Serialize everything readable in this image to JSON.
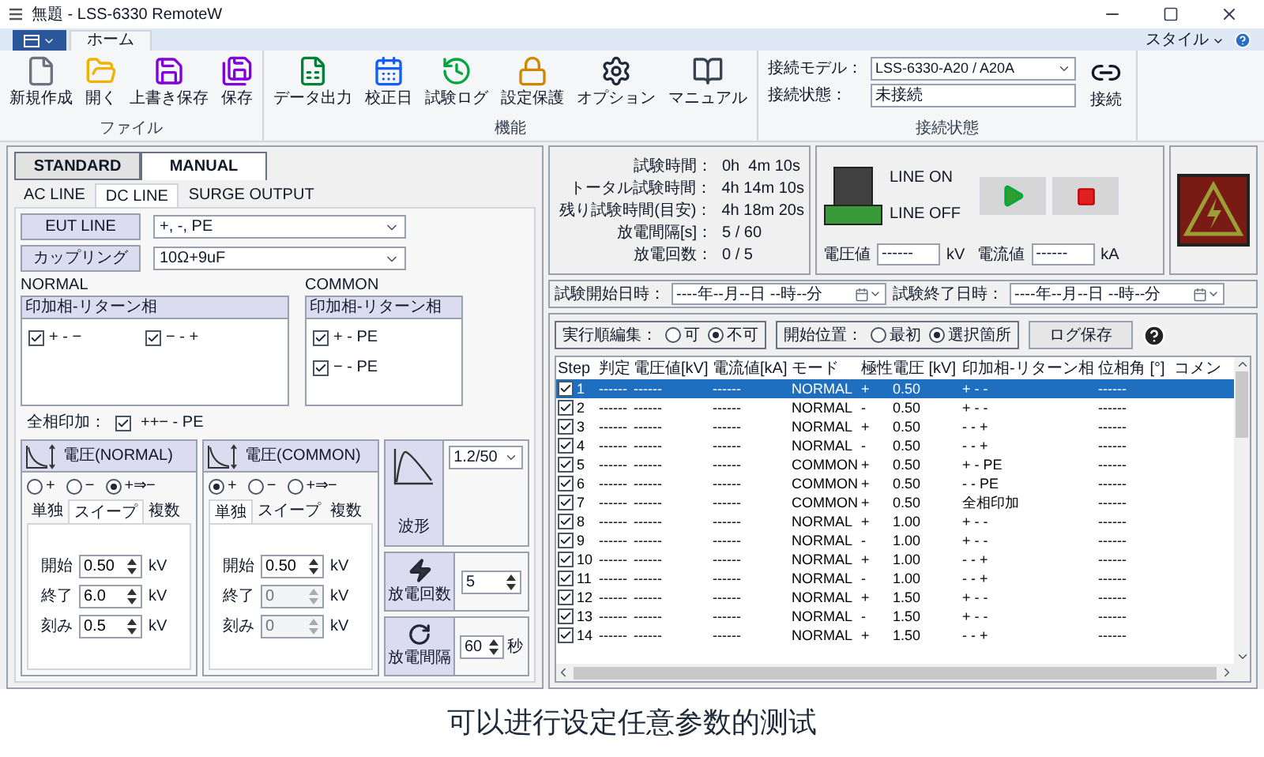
{
  "window": {
    "title": "無題 - LSS-6330 RemoteW",
    "style_menu": "スタイル"
  },
  "ribbon": {
    "tabs": [
      {
        "label": "ホーム",
        "selected": true
      }
    ],
    "groups": [
      {
        "label": "ファイル",
        "buttons": [
          "新規作成",
          "開く",
          "上書き保存",
          "保存"
        ]
      },
      {
        "label": "機能",
        "buttons": [
          "データ出力",
          "校正日",
          "試験ログ",
          "設定保護",
          "オプション",
          "マニュアル"
        ]
      }
    ],
    "connection": {
      "label": "接続状態",
      "model_label": "接続モデル：",
      "model": "LSS-6330-A20 / A20A",
      "status_label": "接続状態：",
      "status": "未接続",
      "connect": "接続"
    }
  },
  "mode_tabs": [
    {
      "label": "STANDARD",
      "selected": false
    },
    {
      "label": "MANUAL",
      "selected": true
    }
  ],
  "line_tabs": [
    {
      "label": "AC LINE",
      "selected": false
    },
    {
      "label": "DC LINE",
      "selected": true
    },
    {
      "label": "SURGE OUTPUT",
      "selected": false
    }
  ],
  "settings": [
    {
      "label": "EUT LINE",
      "value": "+, -, PE"
    },
    {
      "label": "カップリング",
      "value": "10Ω+9uF"
    }
  ],
  "phase_groups": [
    {
      "title": "NORMAL",
      "header": "印加相-リターン相",
      "options": [
        {
          "label": "+ - −",
          "checked": true
        },
        {
          "label": "− - +",
          "checked": true
        }
      ]
    },
    {
      "title": "COMMON",
      "header": "印加相-リターン相",
      "options": [
        {
          "label": "+ - PE",
          "checked": true
        },
        {
          "label": "− - PE",
          "checked": true
        }
      ]
    }
  ],
  "all_phase": {
    "label": "全相印加：",
    "option": {
      "label": "++− - PE",
      "checked": true
    }
  },
  "voltage_panels": [
    {
      "title": "電圧(NORMAL)",
      "polarity": [
        {
          "label": "+",
          "selected": false
        },
        {
          "label": "−",
          "selected": false
        },
        {
          "label": "+⇒−",
          "selected": true
        }
      ],
      "tabs": [
        {
          "label": "単独",
          "selected": false
        },
        {
          "label": "スイープ",
          "selected": true
        },
        {
          "label": "複数",
          "selected": false
        }
      ],
      "fields": [
        {
          "label": "開始",
          "value": "0.50",
          "unit": "kV",
          "disabled": false
        },
        {
          "label": "終了",
          "value": "6.0",
          "unit": "kV",
          "disabled": false
        },
        {
          "label": "刻み",
          "value": "0.5",
          "unit": "kV",
          "disabled": false
        }
      ]
    },
    {
      "title": "電圧(COMMON)",
      "polarity": [
        {
          "label": "+",
          "selected": true
        },
        {
          "label": "−",
          "selected": false
        },
        {
          "label": "+⇒−",
          "selected": false
        }
      ],
      "tabs": [
        {
          "label": "単独",
          "selected": true
        },
        {
          "label": "スイープ",
          "selected": false
        },
        {
          "label": "複数",
          "selected": false
        }
      ],
      "fields": [
        {
          "label": "開始",
          "value": "0.50",
          "unit": "kV",
          "disabled": false
        },
        {
          "label": "終了",
          "value": "0",
          "unit": "kV",
          "disabled": true
        },
        {
          "label": "刻み",
          "value": "0",
          "unit": "kV",
          "disabled": true
        }
      ]
    }
  ],
  "waveform": {
    "label": "波形",
    "value": "1.2/50"
  },
  "discharge_count": {
    "label": "放電回数",
    "value": "5"
  },
  "discharge_interval": {
    "label": "放電間隔",
    "value": "60",
    "unit": "秒"
  },
  "status": [
    {
      "label": "試験時間：",
      "value": "0h  4m 10s"
    },
    {
      "label": "トータル試験時間：",
      "value": "4h 14m 10s"
    },
    {
      "label": "残り試験時間(目安)：",
      "value": "4h 18m 20s"
    },
    {
      "label": "放電間隔[s]：",
      "value": "5 / 60"
    },
    {
      "label": "放電回数：",
      "value": "0 / 5"
    }
  ],
  "line": {
    "on_label": "LINE ON",
    "off_label": "LINE OFF",
    "on": false
  },
  "meters": [
    {
      "label": "電圧値",
      "value": "------",
      "unit": "kV"
    },
    {
      "label": "電流値",
      "value": "------",
      "unit": "kA"
    }
  ],
  "dates": [
    {
      "label": "試験開始日時：",
      "value": "----年--月--日 --時--分"
    },
    {
      "label": "試験終了日時：",
      "value": "----年--月--日 --時--分"
    }
  ],
  "exec_order": {
    "label": "実行順編集：",
    "options": [
      {
        "label": "可",
        "selected": false
      },
      {
        "label": "不可",
        "selected": true
      }
    ]
  },
  "start_position": {
    "label": "開始位置：",
    "options": [
      {
        "label": "最初",
        "selected": false
      },
      {
        "label": "選択箇所",
        "selected": true
      }
    ]
  },
  "log_save": "ログ保存",
  "table": {
    "columns": [
      "Step",
      "判定",
      "電圧値[kV]",
      "電流値[kA]",
      "モード",
      "極性",
      "電圧 [kV]",
      "印加相-リターン相",
      "位相角 [°]",
      "コメン"
    ],
    "rows": [
      {
        "checked": true,
        "selected": true,
        "cells": [
          "1",
          "------",
          "------",
          "------",
          "NORMAL",
          "+",
          "0.50",
          "+ - -",
          "------"
        ]
      },
      {
        "checked": true,
        "selected": false,
        "cells": [
          "2",
          "------",
          "------",
          "------",
          "NORMAL",
          "-",
          "0.50",
          "+ - -",
          "------"
        ]
      },
      {
        "checked": true,
        "selected": false,
        "cells": [
          "3",
          "------",
          "------",
          "------",
          "NORMAL",
          "+",
          "0.50",
          "- - +",
          "------"
        ]
      },
      {
        "checked": true,
        "selected": false,
        "cells": [
          "4",
          "------",
          "------",
          "------",
          "NORMAL",
          "-",
          "0.50",
          "- - +",
          "------"
        ]
      },
      {
        "checked": true,
        "selected": false,
        "cells": [
          "5",
          "------",
          "------",
          "------",
          "COMMON",
          "+",
          "0.50",
          "+ - PE",
          "------"
        ]
      },
      {
        "checked": true,
        "selected": false,
        "cells": [
          "6",
          "------",
          "------",
          "------",
          "COMMON",
          "+",
          "0.50",
          "- - PE",
          "------"
        ]
      },
      {
        "checked": true,
        "selected": false,
        "cells": [
          "7",
          "------",
          "------",
          "------",
          "COMMON",
          "+",
          "0.50",
          "全相印加",
          "------"
        ]
      },
      {
        "checked": true,
        "selected": false,
        "cells": [
          "8",
          "------",
          "------",
          "------",
          "NORMAL",
          "+",
          "1.00",
          "+ - -",
          "------"
        ]
      },
      {
        "checked": true,
        "selected": false,
        "cells": [
          "9",
          "------",
          "------",
          "------",
          "NORMAL",
          "-",
          "1.00",
          "+ - -",
          "------"
        ]
      },
      {
        "checked": true,
        "selected": false,
        "cells": [
          "10",
          "------",
          "------",
          "------",
          "NORMAL",
          "+",
          "1.00",
          "- - +",
          "------"
        ]
      },
      {
        "checked": true,
        "selected": false,
        "cells": [
          "11",
          "------",
          "------",
          "------",
          "NORMAL",
          "-",
          "1.00",
          "- - +",
          "------"
        ]
      },
      {
        "checked": true,
        "selected": false,
        "cells": [
          "12",
          "------",
          "------",
          "------",
          "NORMAL",
          "+",
          "1.50",
          "+ - -",
          "------"
        ]
      },
      {
        "checked": true,
        "selected": false,
        "cells": [
          "13",
          "------",
          "------",
          "------",
          "NORMAL",
          "-",
          "1.50",
          "+ - -",
          "------"
        ]
      },
      {
        "checked": true,
        "selected": false,
        "cells": [
          "14",
          "------",
          "------",
          "------",
          "NORMAL",
          "+",
          "1.50",
          "- - +",
          "------"
        ]
      }
    ]
  },
  "caption": "可以进行设定任意参数的测试"
}
